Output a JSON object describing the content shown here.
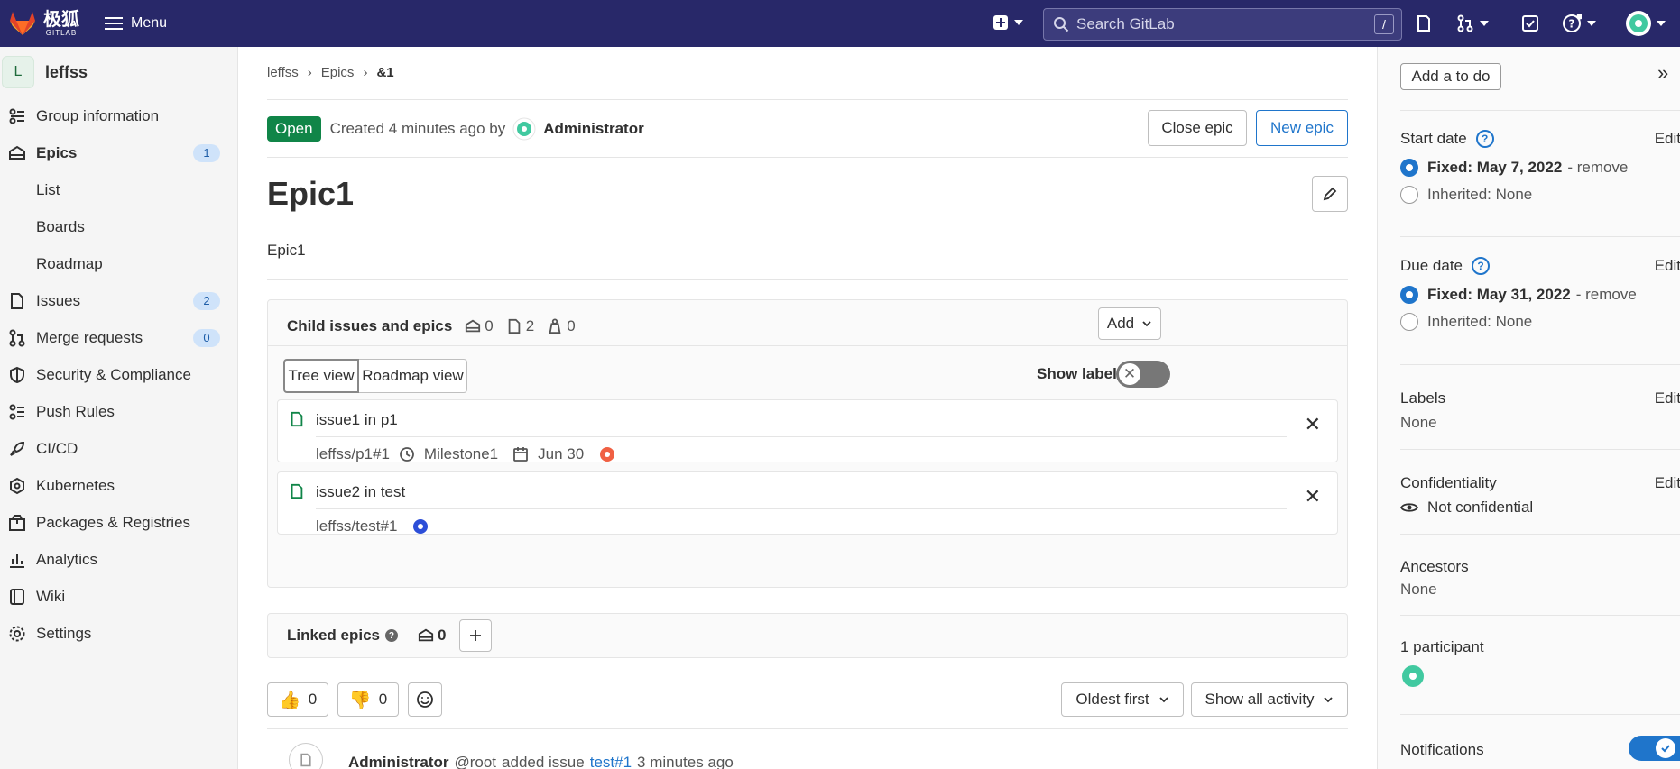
{
  "topbar": {
    "brand_cn": "极狐",
    "brand_en": "GITLAB",
    "menu_label": "Menu",
    "search_placeholder": "Search GitLab",
    "search_shortcut": "/"
  },
  "sidebar": {
    "group_initial": "L",
    "group_name": "leffss",
    "items": [
      {
        "label": "Group information",
        "icon": "group-info-icon"
      },
      {
        "label": "Epics",
        "icon": "epic-icon",
        "badge": "1"
      },
      {
        "label": "List"
      },
      {
        "label": "Boards"
      },
      {
        "label": "Roadmap"
      },
      {
        "label": "Issues",
        "icon": "issues-icon",
        "badge": "2"
      },
      {
        "label": "Merge requests",
        "icon": "merge-request-icon",
        "badge": "0"
      },
      {
        "label": "Security & Compliance",
        "icon": "shield-icon"
      },
      {
        "label": "Push Rules",
        "icon": "push-rules-icon"
      },
      {
        "label": "CI/CD",
        "icon": "rocket-icon"
      },
      {
        "label": "Kubernetes",
        "icon": "kubernetes-icon"
      },
      {
        "label": "Packages & Registries",
        "icon": "package-icon"
      },
      {
        "label": "Analytics",
        "icon": "analytics-icon"
      },
      {
        "label": "Wiki",
        "icon": "book-icon"
      },
      {
        "label": "Settings",
        "icon": "gear-icon"
      }
    ]
  },
  "breadcrumb": [
    "leffss",
    "Epics",
    "&1"
  ],
  "epic": {
    "status": "Open",
    "created_text": "Created 4 minutes ago by",
    "author": "Administrator",
    "close_label": "Close epic",
    "new_label": "New epic",
    "title": "Epic1",
    "description": "Epic1"
  },
  "child_panel": {
    "title": "Child issues and epics",
    "epic_count": "0",
    "issue_count": "2",
    "weight_count": "0",
    "add_label": "Add",
    "tree_view": "Tree view",
    "roadmap_view": "Roadmap view",
    "show_labels": "Show labels",
    "items": [
      {
        "title": "issue1 in p1",
        "ref": "leffss/p1#1",
        "milestone": "Milestone1",
        "due": "Jun 30"
      },
      {
        "title": "issue2 in test",
        "ref": "leffss/test#1"
      }
    ]
  },
  "linked_panel": {
    "title": "Linked epics",
    "count": "0"
  },
  "activity": {
    "thumbs_up": "0",
    "thumbs_down": "0",
    "sort_label": "Oldest first",
    "filter_label": "Show all activity",
    "note_author": "Administrator",
    "note_handle": "@root",
    "note_action": "added issue",
    "note_link": "test#1",
    "note_time": "3 minutes ago"
  },
  "right_sidebar": {
    "todo_label": "Add a to do",
    "edit_label": "Edit",
    "start_date_label": "Start date",
    "start_fixed": "Fixed: May 7, 2022",
    "start_remove": "- remove",
    "start_inherited": "Inherited: None",
    "due_date_label": "Due date",
    "due_fixed": "Fixed: May 31, 2022",
    "due_remove": "- remove",
    "due_inherited": "Inherited: None",
    "labels_label": "Labels",
    "labels_value": "None",
    "confidentiality_label": "Confidentiality",
    "confidentiality_value": "Not confidential",
    "ancestors_label": "Ancestors",
    "ancestors_value": "None",
    "participants_label": "1 participant",
    "notifications_label": "Notifications"
  },
  "colors": {
    "topbar": "#282869",
    "accent": "#1f75cb",
    "open_badge": "#108548"
  }
}
